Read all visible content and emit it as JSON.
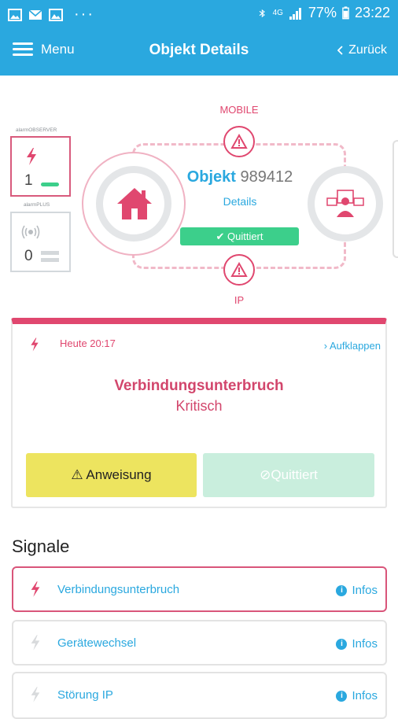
{
  "status_bar": {
    "network": "4G",
    "battery": "77%",
    "time": "23:22",
    "dots": "···"
  },
  "app_bar": {
    "menu_label": "Menu",
    "title": "Objekt Details",
    "back_label": "Zurück",
    "color": "#2aa8df"
  },
  "devices": {
    "observer_label": "alarmOBSERVER",
    "observer_count": "1",
    "plus_label": "alarmPLUS",
    "plus_count": "0"
  },
  "object": {
    "label_mobile": "MOBILE",
    "label_ip": "IP",
    "title_prefix": "Objekt",
    "number": "989412",
    "details_link": "Details",
    "status_badge": "✔ Quittiert"
  },
  "alarm": {
    "time": "Heute 20:17",
    "expand_label": "Aufklappen",
    "title": "Verbindungsunterbruch",
    "severity": "Kritisch",
    "instruction_button": "⚠ Anweisung",
    "ack_button": "⊘Quittiert",
    "accent_color": "#e0476f"
  },
  "signals": {
    "heading": "Signale",
    "info_label": "Infos",
    "items": [
      {
        "name": "Verbindungsunterbruch",
        "active": true
      },
      {
        "name": "Gerätewechsel",
        "active": false
      },
      {
        "name": "Störung IP",
        "active": false
      }
    ]
  }
}
